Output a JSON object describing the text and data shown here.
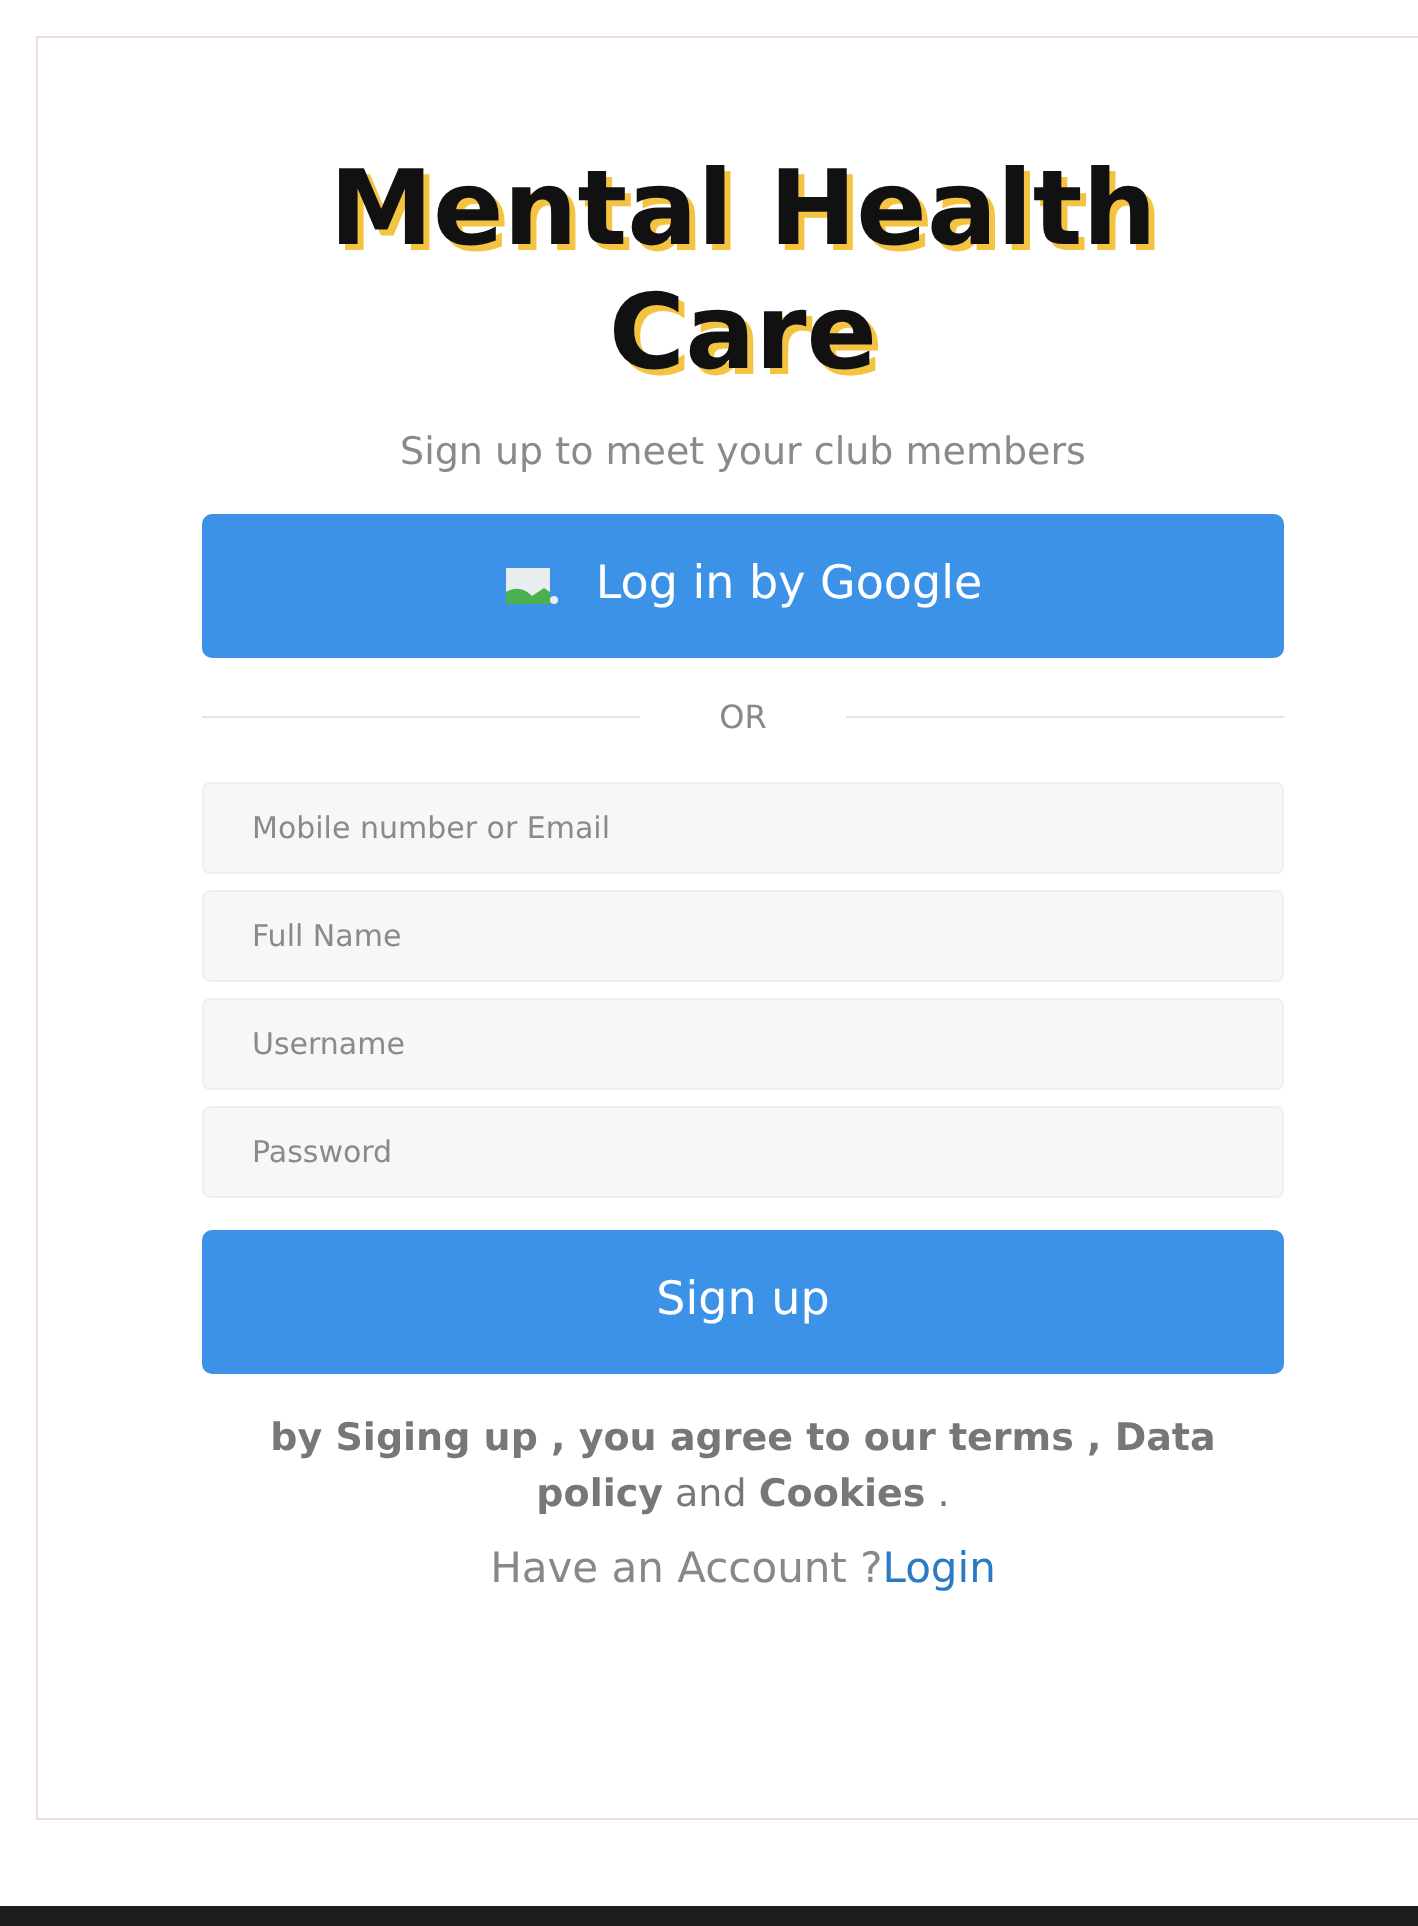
{
  "title": "Mental Health Care",
  "subtitle": "Sign up to meet your club members",
  "google_button": {
    "label": "Log in by Google"
  },
  "divider": "OR",
  "fields": [
    {
      "placeholder": "Mobile number or Email"
    },
    {
      "placeholder": "Full Name"
    },
    {
      "placeholder": "Username"
    },
    {
      "placeholder": "Password"
    }
  ],
  "signup_button": "Sign up",
  "terms": "**by Siging up , you agree to our terms , Data policy** and **Cookies** .",
  "account": {
    "text": "Have an Account ?",
    "link": "Login"
  }
}
